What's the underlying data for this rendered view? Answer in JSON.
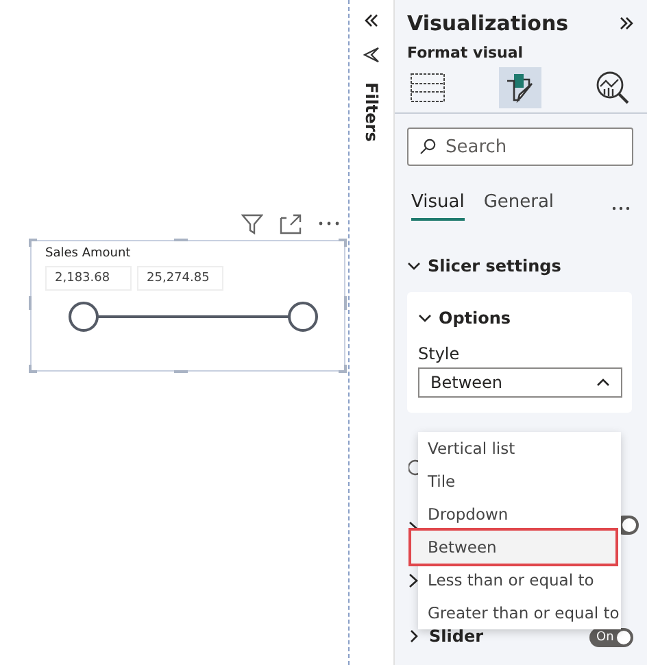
{
  "visual": {
    "title": "Sales Amount",
    "inputs": [
      "2,183.68",
      "25,274.85"
    ],
    "thumbs": [
      {
        "level": 0
      },
      {
        "level": 1
      }
    ]
  },
  "filters": {
    "label": "Filters"
  },
  "pane": {
    "title": "Visualizations",
    "subtitle": "Format visual",
    "view_buttons": [
      {
        "kind": "fields",
        "selected": false
      },
      {
        "kind": "format",
        "selected": true
      },
      {
        "kind": "analytics",
        "selected": false
      }
    ],
    "search": {
      "placeholder": "Search"
    },
    "tabs": [
      {
        "label": "Visual",
        "selected": true
      },
      {
        "label": "General",
        "selected": false
      }
    ],
    "section": {
      "title": "Slicer settings",
      "expanded": true
    },
    "card": {
      "title": "Options",
      "expanded": true,
      "field_label": "Style",
      "value": "Between",
      "open": true
    },
    "options": [
      {
        "label": "Vertical list",
        "highlighted": false
      },
      {
        "label": "Tile",
        "highlighted": false
      },
      {
        "label": "Dropdown",
        "highlighted": false
      },
      {
        "label": "Between",
        "highlighted": true
      },
      {
        "label": "Less than or equal to",
        "highlighted": false
      },
      {
        "label": "Greater than or equal to",
        "highlighted": false
      }
    ],
    "covered_toggle": {
      "on": true
    },
    "slider": {
      "label": "Slider",
      "toggle": "On",
      "on": true
    }
  }
}
